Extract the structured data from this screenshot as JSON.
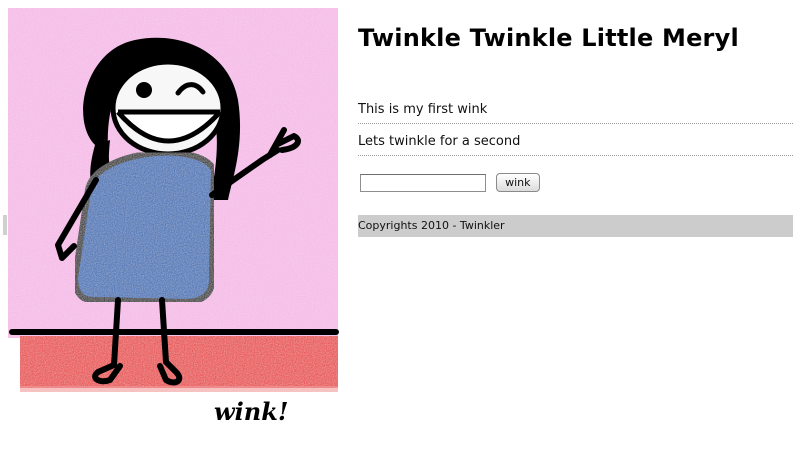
{
  "header": {
    "title": "Twinkle Twinkle Little Meryl"
  },
  "illustration": {
    "caption": "wink!"
  },
  "winks": [
    {
      "text": "This is my first wink"
    },
    {
      "text": "Lets twinkle for a second"
    }
  ],
  "form": {
    "input_value": "",
    "button_label": "wink"
  },
  "footer": {
    "text": "Copyrights 2010 - Twinkler"
  },
  "colors": {
    "background_pink": "#f4b7e6",
    "floor_red": "#e83a3a",
    "dress_blue": "#2f6ab3",
    "footer_gray": "#cccccc"
  }
}
